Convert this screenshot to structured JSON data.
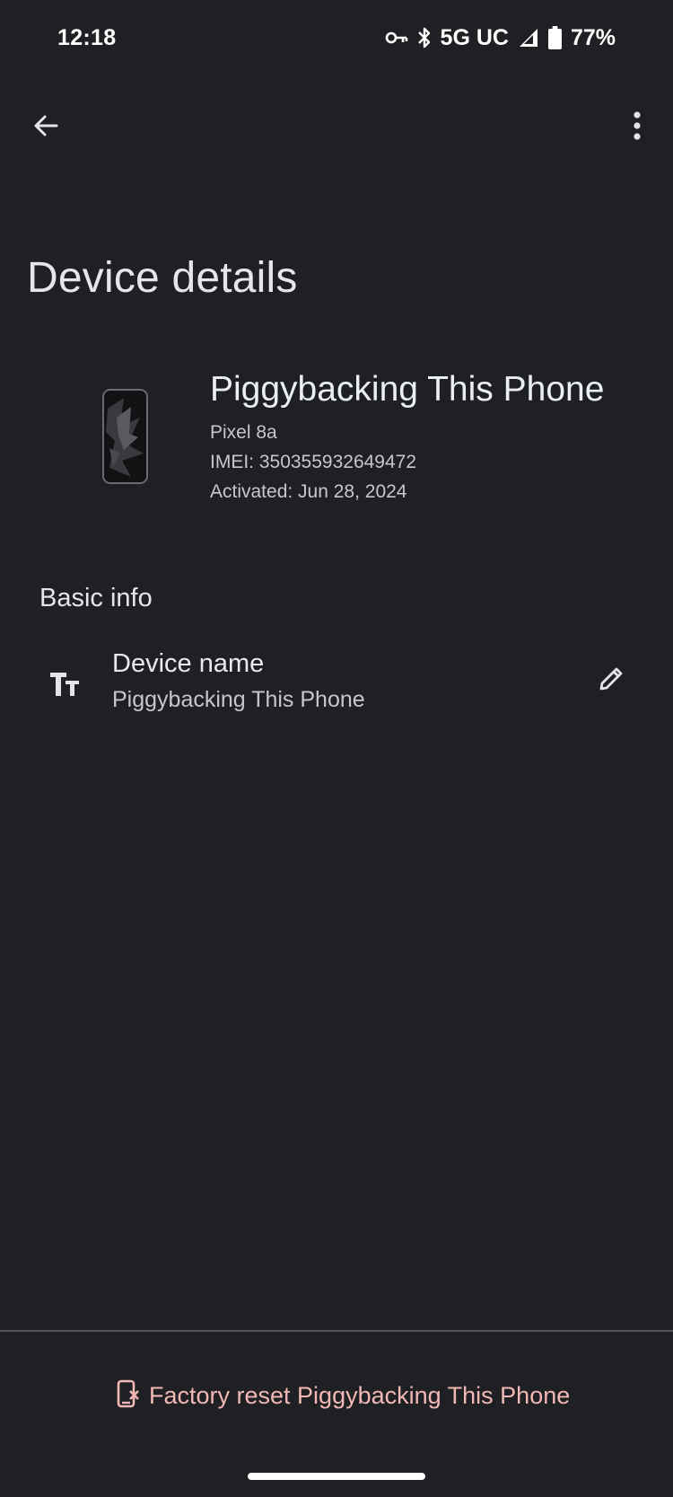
{
  "status_bar": {
    "time": "12:18",
    "network": "5G UC",
    "battery": "77%",
    "icons": [
      "vpn-key-icon",
      "bluetooth-icon",
      "signal-icon",
      "battery-icon"
    ]
  },
  "app_bar": {
    "back_icon": "arrow-back-icon",
    "more_icon": "more-vert-icon"
  },
  "page": {
    "title": "Device details"
  },
  "device": {
    "name": "Piggybacking This Phone",
    "model": "Pixel 8a",
    "imei": "IMEI: 350355932649472",
    "activated": "Activated: Jun 28, 2024"
  },
  "basic_info": {
    "section_label": "Basic info",
    "rows": [
      {
        "icon": "text-fields-icon",
        "title": "Device name",
        "value": "Piggybacking This Phone",
        "action_icon": "edit-pencil-icon"
      }
    ]
  },
  "footer": {
    "factory_reset_label": "Factory reset Piggybacking This Phone",
    "factory_reset_icon": "phone-reset-icon"
  },
  "colors": {
    "background": "#1f2024",
    "text_primary": "#e6e6ea",
    "text_secondary": "#c6c6cc",
    "danger": "#f2b8b5",
    "divider": "#505257"
  }
}
